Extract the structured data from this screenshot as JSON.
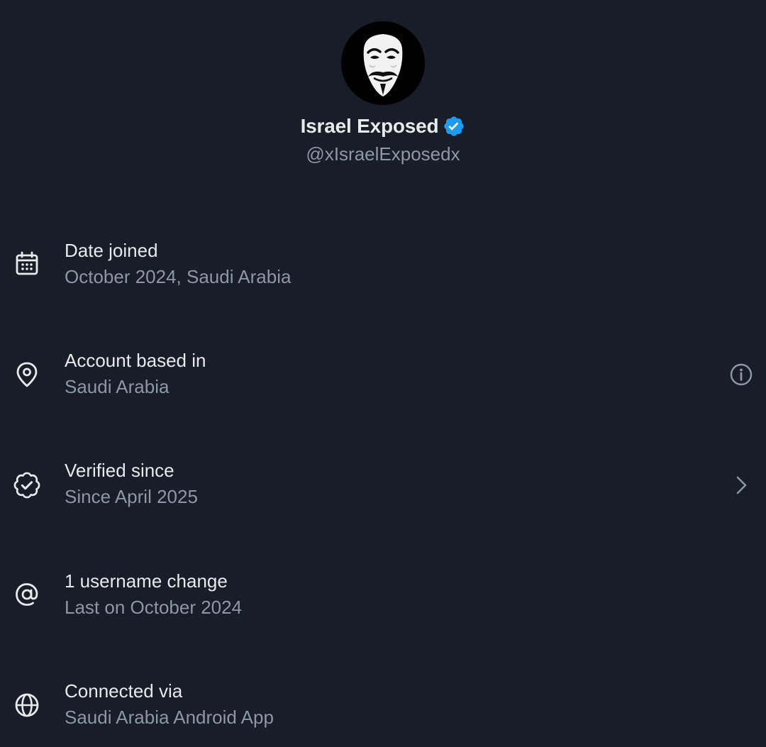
{
  "profile": {
    "display_name": "Israel Exposed",
    "handle": "@xIsraelExposedx",
    "verified": true,
    "badge_color": "#1d9bf0",
    "avatar_icon": "guy-fawkes-mask-avatar"
  },
  "rows": [
    {
      "title": "Date joined",
      "subtitle": "October 2024, Saudi Arabia",
      "icon": "calendar-icon"
    },
    {
      "title": "Account based in",
      "subtitle": "Saudi Arabia",
      "icon": "location-pin-icon",
      "action_icon": "info-icon"
    },
    {
      "title": "Verified since",
      "subtitle": "Since April 2025",
      "icon": "verified-badge-icon",
      "action_icon": "chevron-right-icon"
    },
    {
      "title": "1 username change",
      "subtitle": "Last on October 2024",
      "icon": "at-sign-icon"
    },
    {
      "title": "Connected via",
      "subtitle": "Saudi Arabia Android App",
      "icon": "globe-icon"
    }
  ],
  "colors": {
    "background": "#181d27",
    "primary_text": "#e7e9ea",
    "secondary_text": "#8b98a5",
    "accent": "#1d9bf0"
  }
}
